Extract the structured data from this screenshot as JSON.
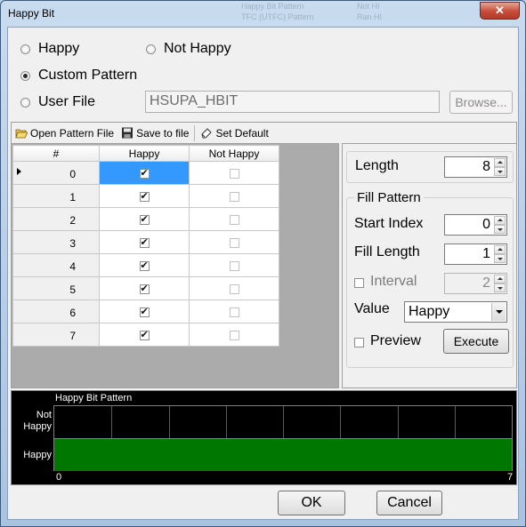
{
  "window": {
    "title": "Happy Bit",
    "close_glyph": "✕"
  },
  "background_ghost": [
    "Happy Bit Pattern",
    "TFC (UTFC) Pattern",
    "Not HI",
    "Ran HI"
  ],
  "mode": {
    "options": [
      {
        "label": "Happy",
        "selected": false
      },
      {
        "label": "Not Happy",
        "selected": false
      },
      {
        "label": "Custom Pattern",
        "selected": true
      },
      {
        "label": "User File",
        "selected": false
      }
    ],
    "user_file_value": "HSUPA_HBIT",
    "browse_label": "Browse..."
  },
  "toolbar": {
    "open_label": "Open Pattern File",
    "save_label": "Save to file",
    "default_label": "Set Default",
    "open_icon": "folder-open-icon",
    "save_icon": "floppy-disk-icon",
    "default_icon": "eraser-icon"
  },
  "grid": {
    "headers": [
      "#",
      "Happy",
      "Not Happy"
    ],
    "rows": [
      {
        "index": "0",
        "happy": true,
        "not_happy": false
      },
      {
        "index": "1",
        "happy": true,
        "not_happy": false
      },
      {
        "index": "2",
        "happy": true,
        "not_happy": false
      },
      {
        "index": "3",
        "happy": true,
        "not_happy": false
      },
      {
        "index": "4",
        "happy": true,
        "not_happy": false
      },
      {
        "index": "5",
        "happy": true,
        "not_happy": false
      },
      {
        "index": "6",
        "happy": true,
        "not_happy": false
      },
      {
        "index": "7",
        "happy": true,
        "not_happy": false
      }
    ],
    "selected_row": 0
  },
  "settings": {
    "length_label": "Length",
    "length_value": "8",
    "fill_title": "Fill Pattern",
    "start_index_label": "Start Index",
    "start_index_value": "0",
    "fill_length_label": "Fill Length",
    "fill_length_value": "1",
    "interval_label": "Interval",
    "interval_value": "2",
    "interval_checked": false,
    "value_label": "Value",
    "value_selected": "Happy",
    "preview_label": "Preview",
    "preview_checked": false,
    "execute_label": "Execute"
  },
  "chart_data": {
    "type": "bar",
    "title": "Happy Bit Pattern",
    "categories": [
      "0",
      "1",
      "2",
      "3",
      "4",
      "5",
      "6",
      "7"
    ],
    "ylabels": [
      "Not Happy",
      "Happy"
    ],
    "values": [
      "Happy",
      "Happy",
      "Happy",
      "Happy",
      "Happy",
      "Happy",
      "Happy",
      "Happy"
    ],
    "x_tick_labels": [
      "0",
      "7"
    ],
    "bar_color": "#007800",
    "background": "#000000"
  },
  "footer": {
    "ok_label": "OK",
    "cancel_label": "Cancel"
  }
}
